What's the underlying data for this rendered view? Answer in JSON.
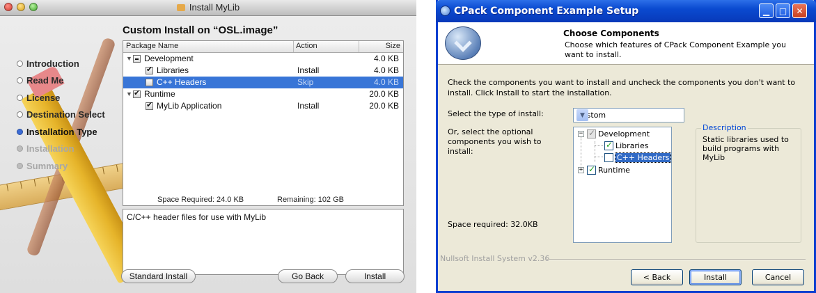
{
  "mac": {
    "window_title": "Install MyLib",
    "heading": "Custom Install on “OSL.image”",
    "steps": [
      {
        "label": "Introduction",
        "state": "done"
      },
      {
        "label": "Read Me",
        "state": "done"
      },
      {
        "label": "License",
        "state": "done"
      },
      {
        "label": "Destination Select",
        "state": "done"
      },
      {
        "label": "Installation Type",
        "state": "current"
      },
      {
        "label": "Installation",
        "state": "pending"
      },
      {
        "label": "Summary",
        "state": "pending"
      }
    ],
    "table": {
      "columns": [
        "Package Name",
        "Action",
        "Size"
      ],
      "rows": [
        {
          "name": "Development",
          "action": "",
          "size": "4.0 KB",
          "check": "mixed",
          "expanded": true,
          "level": 0
        },
        {
          "name": "Libraries",
          "action": "Install",
          "size": "4.0 KB",
          "check": "checked",
          "level": 1
        },
        {
          "name": "C++ Headers",
          "action": "Skip",
          "size": "4.0 KB",
          "check": "unchecked",
          "level": 1,
          "selected": true
        },
        {
          "name": "Runtime",
          "action": "",
          "size": "20.0 KB",
          "check": "checked",
          "expanded": true,
          "level": 0
        },
        {
          "name": "MyLib Application",
          "action": "Install",
          "size": "20.0 KB",
          "check": "checked",
          "level": 1
        }
      ]
    },
    "space_required": "Space Required:  24.0 KB",
    "remaining": "Remaining:  102 GB",
    "description": "C/C++ header files for use with MyLib",
    "buttons": {
      "standard": "Standard Install",
      "back": "Go Back",
      "install": "Install"
    },
    "selection_color": "#3875d7"
  },
  "win": {
    "window_title": "CPack Component Example Setup",
    "header_title": "Choose Components",
    "header_subtitle": "Choose which features of CPack Component Example you want to install.",
    "intro": "Check the components you want to install and uncheck the components you don't want to install. Click Install to start the installation.",
    "type_label": "Select the type of install:",
    "type_value": "Custom",
    "optional_label": "Or, select the optional components you wish to install:",
    "tree": [
      {
        "label": "Development",
        "check": "grey",
        "expanded": true
      },
      {
        "label": "Libraries",
        "check": "checked"
      },
      {
        "label": "C++ Headers",
        "check": "unchecked",
        "selected": true
      },
      {
        "label": "Runtime",
        "check": "checked",
        "expanded": false
      }
    ],
    "description_legend": "Description",
    "description_text": "Static libraries used to build programs with MyLib",
    "space_required": "Space required: 32.0KB",
    "nsis": "Nullsoft Install System v2.36",
    "buttons": {
      "back": "< Back",
      "install": "Install",
      "cancel": "Cancel"
    },
    "titlebar_color": "#0a4ad0",
    "selection_color": "#316ac5"
  }
}
